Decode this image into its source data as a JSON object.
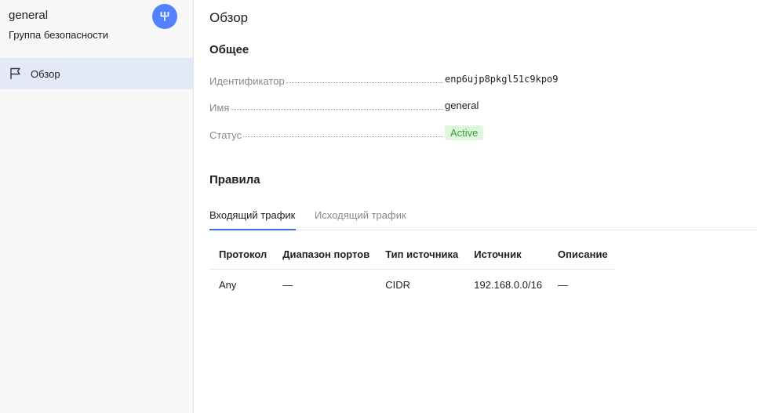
{
  "sidebar": {
    "title": "general",
    "subtitle": "Группа безопасности",
    "badge_icon": "vpc-network-icon",
    "badge_color": "#5282ff",
    "nav_items": [
      {
        "label": "Обзор",
        "icon": "flag-icon",
        "active": true
      }
    ]
  },
  "main": {
    "page_title": "Обзор",
    "general": {
      "title": "Общее",
      "id_key": "Идентификатор",
      "id_value": "enp6ujp8pkgl51c9kpo9",
      "name_key": "Имя",
      "name_value": "general",
      "status_key": "Статус",
      "status_value": "Active",
      "status_color": "#36a034"
    },
    "rules": {
      "title": "Правила",
      "tabs": [
        {
          "label": "Входящий трафик",
          "active": true
        },
        {
          "label": "Исходящий трафик",
          "active": false
        }
      ],
      "columns": [
        "Протокол",
        "Диапазон портов",
        "Тип источника",
        "Источник",
        "Описание"
      ],
      "rows": [
        [
          "Any",
          "—",
          "CIDR",
          "192.168.0.0/16",
          "—"
        ]
      ]
    }
  }
}
